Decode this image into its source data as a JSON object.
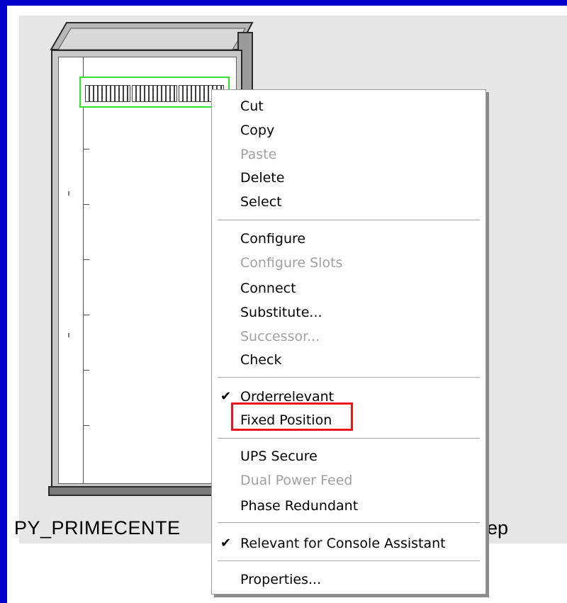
{
  "rack": {
    "label": "PY_PRIMECENTE",
    "label_tail": "ep"
  },
  "context_menu": {
    "items": [
      {
        "label": "Cut",
        "enabled": true
      },
      {
        "label": "Copy",
        "enabled": true
      },
      {
        "label": "Paste",
        "enabled": false
      },
      {
        "label": "Delete",
        "enabled": true
      },
      {
        "label": "Select",
        "enabled": true
      },
      {
        "label": "Configure",
        "enabled": true
      },
      {
        "label": "Configure Slots",
        "enabled": false
      },
      {
        "label": "Connect",
        "enabled": true
      },
      {
        "label": "Substitute...",
        "enabled": true
      },
      {
        "label": "Successor...",
        "enabled": false
      },
      {
        "label": "Check",
        "enabled": true
      },
      {
        "label": "Orderrelevant",
        "enabled": true,
        "checked": true
      },
      {
        "label": "Fixed Position",
        "enabled": true,
        "highlighted": true
      },
      {
        "label": "UPS Secure",
        "enabled": true
      },
      {
        "label": "Dual Power Feed",
        "enabled": false
      },
      {
        "label": "Phase Redundant",
        "enabled": true
      },
      {
        "label": "Relevant for Console Assistant",
        "enabled": true,
        "checked": true
      },
      {
        "label": "Properties...",
        "enabled": true
      }
    ],
    "check_glyph": "✔"
  },
  "colors": {
    "window_border": "#0000cc",
    "canvas": "#e6e6e6",
    "selection": "#32e032",
    "highlight": "#e8141e",
    "disabled_text": "#a0a0a0"
  }
}
